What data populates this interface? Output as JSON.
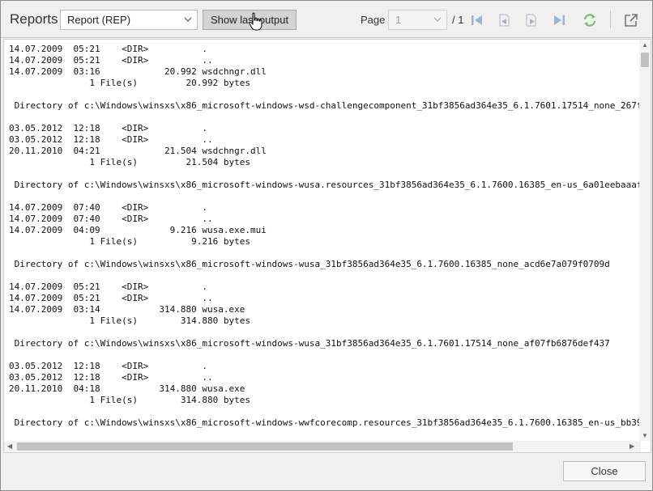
{
  "toolbar": {
    "title": "Reports",
    "report_select": {
      "value": "Report (REP)"
    },
    "show_button_label": "Show last output",
    "page_label": "Page",
    "page_value": "1",
    "page_total": "/ 1",
    "icons": [
      "first-page-icon",
      "prev-page-icon",
      "next-page-icon",
      "last-page-icon",
      "refresh-icon",
      "popout-icon"
    ]
  },
  "output": {
    "lines": [
      "14.07.2009  05:21    <DIR>          .",
      "14.07.2009  05:21    <DIR>          ..",
      "14.07.2009  03:16            20.992 wsdchngr.dll",
      "               1 File(s)         20.992 bytes",
      "",
      " Directory of c:\\Windows\\winsxs\\x86_microsoft-windows-wsd-challengecomponent_31bf3856ad364e35_6.1.7601.17514_none_267f",
      "",
      "03.05.2012  12:18    <DIR>          .",
      "03.05.2012  12:18    <DIR>          ..",
      "20.11.2010  04:21            21.504 wsdchngr.dll",
      "               1 File(s)         21.504 bytes",
      "",
      " Directory of c:\\Windows\\winsxs\\x86_microsoft-windows-wusa.resources_31bf3856ad364e35_6.1.7600.16385_en-us_6a01eebaaaf",
      "",
      "14.07.2009  07:40    <DIR>          .",
      "14.07.2009  07:40    <DIR>          ..",
      "14.07.2009  04:09             9.216 wusa.exe.mui",
      "               1 File(s)          9.216 bytes",
      "",
      " Directory of c:\\Windows\\winsxs\\x86_microsoft-windows-wusa_31bf3856ad364e35_6.1.7600.16385_none_acd6e7a079f0709d",
      "",
      "14.07.2009  05:21    <DIR>          .",
      "14.07.2009  05:21    <DIR>          ..",
      "14.07.2009  03:14           314.880 wusa.exe",
      "               1 File(s)        314.880 bytes",
      "",
      " Directory of c:\\Windows\\winsxs\\x86_microsoft-windows-wusa_31bf3856ad364e35_6.1.7601.17514_none_af07fb6876def437",
      "",
      "03.05.2012  12:18    <DIR>          .",
      "03.05.2012  12:18    <DIR>          ..",
      "20.11.2010  04:18           314.880 wusa.exe",
      "               1 File(s)        314.880 bytes",
      "",
      " Directory of c:\\Windows\\winsxs\\x86_microsoft-windows-wwfcorecomp.resources_31bf3856ad364e35_6.1.7600.16385_en-us_bb39"
    ]
  },
  "footer": {
    "close_label": "Close"
  },
  "colors": {
    "window_bg": "#f0f0f0",
    "show_button_bg": "#d3d3d3",
    "icon_blue": "#9fb4cc",
    "refresh_green": "#6fbf6f"
  }
}
